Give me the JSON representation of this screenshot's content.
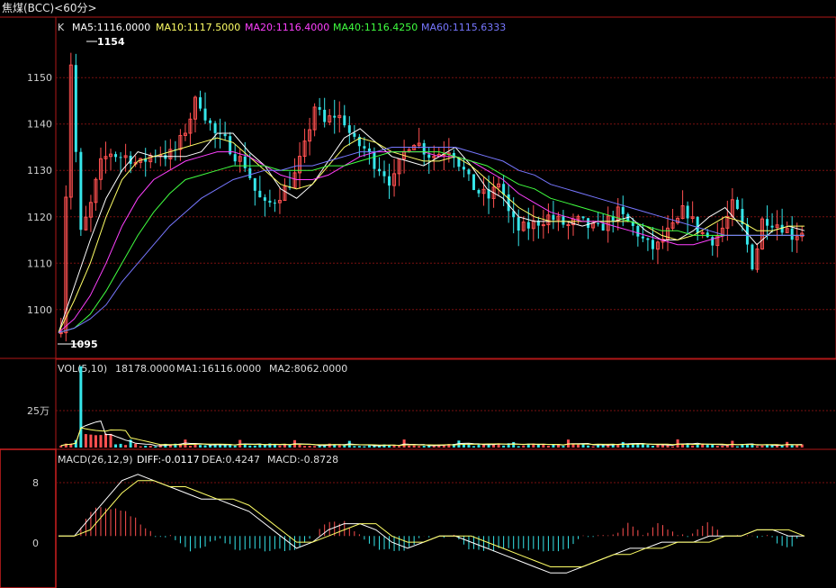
{
  "title": "焦煤(BCC)<60分>",
  "colors": {
    "bg": "#000000",
    "frame": "#b01818",
    "grid": "#7a1010",
    "up": "#ff5050",
    "down": "#35e6ea",
    "ma5": "#ffffff",
    "ma10": "#ffff66",
    "ma20": "#ff40ff",
    "ma40": "#40ff40",
    "ma60": "#7777ff"
  },
  "price_panel": {
    "legend_k": "K",
    "ma5": "MA5:1116.0000",
    "ma10": "MA10:1117.5000",
    "ma20": "MA20:1116.4000",
    "ma40": "MA40:1116.4250",
    "ma60": "MA60:1115.6333",
    "high_mark": "1154",
    "low_mark": "1095"
  },
  "volume_panel": {
    "legend_vol": "VOL(5,10)",
    "legend_value": "18178.0000",
    "ma1": "MA1:16116.0000",
    "ma2": "MA2:8062.0000",
    "tick": "25万"
  },
  "macd_panel": {
    "legend_macd": "MACD(26,12,9)",
    "diff": "DIFF:-0.0117",
    "dea": "DEA:0.4247",
    "macd": "MACD:-0.8728",
    "ticks": [
      "8",
      "0"
    ]
  },
  "chart_data": {
    "type": "candlestick",
    "price_axis": {
      "ticks": [
        1150,
        1140,
        1130,
        1120,
        1110,
        1100
      ],
      "ylim": [
        1092,
        1158
      ]
    },
    "volume_axis": {
      "ylim": [
        0,
        400000
      ]
    },
    "macd_axis": {
      "ylim": [
        -8,
        11
      ]
    },
    "price_path": [
      1095,
      1154,
      1116,
      1122,
      1131,
      1134,
      1133,
      1133,
      1131,
      1133,
      1134,
      1133,
      1135,
      1140,
      1146,
      1141,
      1137,
      1136,
      1133,
      1131,
      1125,
      1122,
      1124,
      1126,
      1129,
      1135,
      1144,
      1140,
      1142,
      1141,
      1136,
      1135,
      1132,
      1130,
      1127,
      1133,
      1137,
      1135,
      1133,
      1134,
      1135,
      1131,
      1127,
      1125,
      1124,
      1128,
      1120,
      1117,
      1118,
      1119,
      1120,
      1119,
      1118,
      1119,
      1118,
      1117,
      1119,
      1121,
      1119,
      1117,
      1114,
      1113,
      1116,
      1118,
      1122,
      1118,
      1116,
      1115,
      1118,
      1123,
      1117,
      1109,
      1120,
      1119,
      1118,
      1116,
      1117
    ],
    "ma_lines": {
      "MA5": [
        1095,
        1105,
        1115,
        1124,
        1130,
        1134,
        1133,
        1133,
        1133,
        1134,
        1138,
        1138,
        1134,
        1131,
        1126,
        1124,
        1127,
        1132,
        1137,
        1139,
        1136,
        1133,
        1132,
        1131,
        1133,
        1135,
        1131,
        1126,
        1124,
        1120,
        1119,
        1119,
        1119,
        1118,
        1119,
        1119,
        1120,
        1117,
        1115,
        1115,
        1117,
        1120,
        1122,
        1118,
        1114,
        1117,
        1118,
        1117
      ],
      "MA10": [
        1095,
        1102,
        1110,
        1120,
        1128,
        1132,
        1133,
        1134,
        1135,
        1136,
        1137,
        1136,
        1133,
        1130,
        1127,
        1126,
        1127,
        1131,
        1135,
        1137,
        1136,
        1134,
        1133,
        1132,
        1132,
        1133,
        1131,
        1128,
        1125,
        1122,
        1120,
        1119,
        1119,
        1119,
        1119,
        1119,
        1119,
        1118,
        1116,
        1115,
        1116,
        1118,
        1120,
        1119,
        1117,
        1117,
        1118,
        1118
      ],
      "MA20": [
        1095,
        1098,
        1103,
        1110,
        1118,
        1124,
        1128,
        1130,
        1132,
        1133,
        1134,
        1134,
        1133,
        1131,
        1129,
        1128,
        1128,
        1129,
        1131,
        1133,
        1134,
        1134,
        1134,
        1134,
        1133,
        1133,
        1132,
        1130,
        1128,
        1125,
        1123,
        1121,
        1120,
        1119,
        1119,
        1118,
        1117,
        1116,
        1115,
        1114,
        1114,
        1115,
        1116,
        1116,
        1116,
        1116,
        1116,
        1116
      ],
      "MA40": [
        1095,
        1096,
        1099,
        1104,
        1110,
        1116,
        1121,
        1125,
        1128,
        1129,
        1130,
        1131,
        1131,
        1131,
        1130,
        1130,
        1130,
        1131,
        1131,
        1132,
        1133,
        1134,
        1134,
        1134,
        1134,
        1133,
        1132,
        1131,
        1129,
        1127,
        1126,
        1124,
        1123,
        1122,
        1121,
        1120,
        1119,
        1118,
        1117,
        1117,
        1116,
        1116,
        1116,
        1116,
        1116,
        1116,
        1116,
        1116
      ],
      "MA60": [
        1095,
        1096,
        1098,
        1101,
        1106,
        1110,
        1114,
        1118,
        1121,
        1124,
        1126,
        1128,
        1129,
        1130,
        1130,
        1131,
        1131,
        1132,
        1133,
        1134,
        1134,
        1135,
        1135,
        1135,
        1135,
        1135,
        1134,
        1133,
        1132,
        1130,
        1129,
        1127,
        1126,
        1125,
        1124,
        1123,
        1122,
        1121,
        1120,
        1119,
        1118,
        1117,
        1116,
        1116,
        1116,
        1116,
        1116,
        1116
      ]
    },
    "macd_lines": {
      "DIFF": [
        0,
        0,
        3,
        6,
        9,
        10,
        9,
        8,
        7,
        6,
        6,
        5,
        4,
        2,
        0,
        -2,
        -1,
        1,
        2,
        2,
        1,
        -1,
        -2,
        -1,
        0,
        0,
        -1,
        -2,
        -3,
        -4,
        -5,
        -6,
        -6,
        -5,
        -4,
        -3,
        -2,
        -2,
        -1,
        -1,
        -1,
        0,
        0,
        0,
        1,
        1,
        0,
        0
      ],
      "DEA": [
        0,
        0,
        1,
        4,
        7,
        9,
        9,
        8,
        8,
        7,
        6,
        6,
        5,
        3,
        1,
        -1,
        -1,
        0,
        1,
        2,
        2,
        0,
        -1,
        -1,
        0,
        0,
        0,
        -1,
        -2,
        -3,
        -4,
        -5,
        -5,
        -5,
        -4,
        -3,
        -3,
        -2,
        -2,
        -1,
        -1,
        -1,
        0,
        0,
        1,
        1,
        1,
        0
      ]
    }
  }
}
